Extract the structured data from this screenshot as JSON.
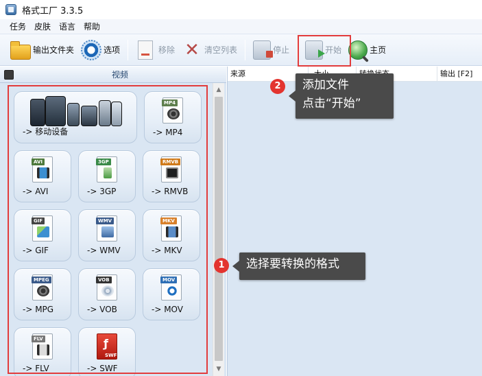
{
  "window": {
    "title": "格式工厂 3.3.5"
  },
  "menu": [
    "任务",
    "皮肤",
    "语言",
    "帮助"
  ],
  "toolbar": {
    "output_folder": "输出文件夹",
    "options": "选项",
    "remove": "移除",
    "clear_list": "清空列表",
    "stop": "停止",
    "start": "开始",
    "home": "主页"
  },
  "left_panel": {
    "header": "视频",
    "formats": [
      {
        "label": "-> 移动设备",
        "icon": "mobile-devices-icon"
      },
      {
        "label": "-> MP4",
        "badge": "MP4",
        "icon": "mp4-file-icon"
      },
      {
        "label": "-> AVI",
        "badge": "AVI",
        "icon": "avi-file-icon"
      },
      {
        "label": "-> 3GP",
        "badge": "3GP",
        "icon": "3gp-file-icon"
      },
      {
        "label": "-> RMVB",
        "badge": "RMVB",
        "icon": "rmvb-file-icon"
      },
      {
        "label": "-> GIF",
        "badge": "GIF",
        "icon": "gif-file-icon"
      },
      {
        "label": "-> WMV",
        "badge": "WMV",
        "icon": "wmv-file-icon"
      },
      {
        "label": "-> MKV",
        "badge": "MKV",
        "icon": "mkv-file-icon"
      },
      {
        "label": "-> MPG",
        "badge": "MPEG",
        "icon": "mpg-file-icon"
      },
      {
        "label": "-> VOB",
        "badge": "VOB",
        "icon": "vob-file-icon"
      },
      {
        "label": "-> MOV",
        "badge": "MOV",
        "icon": "mov-file-icon"
      },
      {
        "label": "-> FLV",
        "badge": "FLV",
        "icon": "flv-file-icon"
      },
      {
        "label": "-> SWF",
        "badge": "SWF",
        "icon": "swf-file-icon"
      }
    ]
  },
  "task_list": {
    "columns": [
      "来源",
      "大小",
      "转换状态",
      "输出 [F2]"
    ]
  },
  "callouts": [
    {
      "number": "2",
      "line1": "添加文件",
      "line2": "点击“开始”"
    },
    {
      "number": "1",
      "line1": "选择要转换的格式"
    }
  ],
  "colors": {
    "highlight": "#e23b3b",
    "callout_bg": "#4a4a4a",
    "badge_bg": "#e3342f",
    "panel_bg": "#dae6f3"
  }
}
